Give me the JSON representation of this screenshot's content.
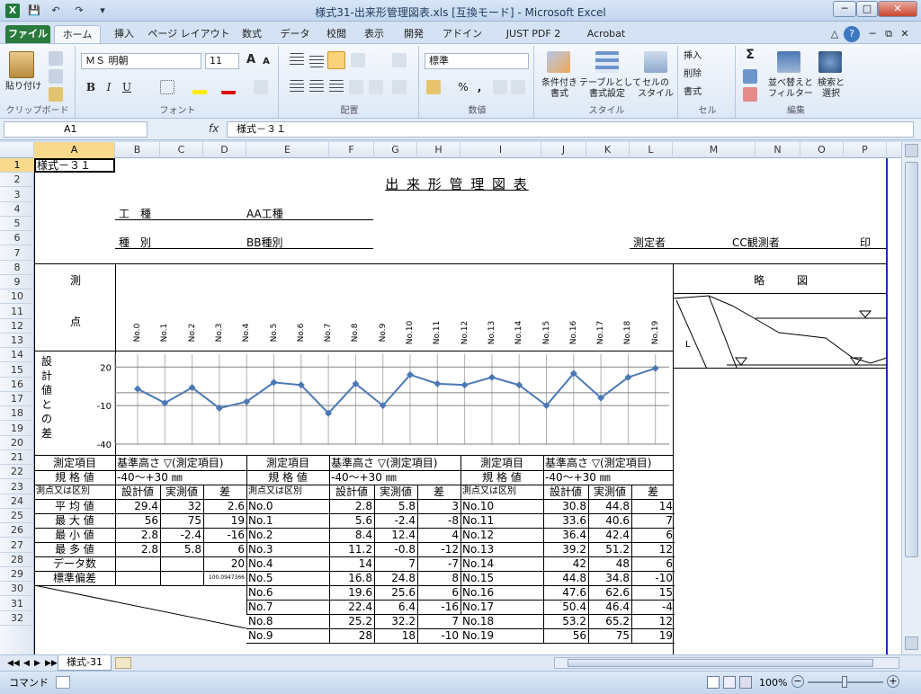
{
  "window": {
    "title": "様式31-出来形管理図表.xls  [互換モード] - Microsoft Excel",
    "app_icon": "X",
    "quick_access": {
      "save": "💾",
      "undo": "↶",
      "redo": "↷",
      "customize": "▾"
    },
    "controls": {
      "minimize": "─",
      "maximize": "□",
      "close": "✕"
    }
  },
  "ribbon_tabs": [
    "ファイル",
    "ホーム",
    "挿入",
    "ページ レイアウト",
    "数式",
    "データ",
    "校閲",
    "表示",
    "開発",
    "アドイン",
    "JUST PDF 2",
    "Acrobat"
  ],
  "ribbon_right": {
    "minimize_ribbon": "△",
    "help": "?",
    "win_min": "─",
    "win_restore": "⧉",
    "win_close": "✕"
  },
  "ribbon": {
    "clipboard": {
      "paste": "貼り付け",
      "label": "クリップボード"
    },
    "font": {
      "name": "ＭＳ 明朝",
      "size": "11",
      "grow": "A",
      "shrink": "A",
      "bold": "B",
      "italic": "I",
      "underline": "U",
      "label": "フォント"
    },
    "alignment": {
      "label": "配置"
    },
    "number": {
      "format": "標準",
      "percent": "%",
      "comma": ",",
      "label": "数値"
    },
    "style": {
      "conditional": "条件付き\n書式",
      "table": "テーブルとして\n書式設定",
      "cell": "セルの\nスタイル",
      "label": "スタイル"
    },
    "cells": {
      "insert": "挿入",
      "delete": "削除",
      "format": "書式",
      "label": "セル"
    },
    "editing": {
      "sum": "Σ",
      "sort": "並べ替えと\nフィルター",
      "find": "検索と\n選択",
      "label": "編集"
    }
  },
  "formula_bar": {
    "name_box": "A1",
    "fx": "fx",
    "content": "様式－３１"
  },
  "columns": [
    "A",
    "B",
    "C",
    "D",
    "E",
    "F",
    "G",
    "H",
    "I",
    "J",
    "K",
    "L",
    "M",
    "N",
    "O",
    "P"
  ],
  "rows": [
    "1",
    "2",
    "3",
    "4",
    "5",
    "6",
    "7",
    "8",
    "9",
    "10",
    "11",
    "12",
    "13",
    "14",
    "15",
    "16",
    "17",
    "18",
    "19",
    "20",
    "21",
    "22",
    "23",
    "24",
    "25",
    "26",
    "27",
    "28",
    "29",
    "30",
    "31",
    "32"
  ],
  "sheet": {
    "form_no": "様式－３１",
    "title": "出 来 形 管 理 図 表",
    "koushu_label": "工　種",
    "koushu_value": "AA工種",
    "shubetsu_label": "種　別",
    "shubetsu_value": "BB種別",
    "sokuteisha_label": "測定者",
    "sokuteisha_value": "CC観測者",
    "seal": "印",
    "sokuten_1": "測",
    "sokuten_2": "点",
    "ryakuzu": "略　　　図",
    "sketch_label": "L",
    "diff_label": [
      "設",
      "計",
      "値",
      "と",
      "の",
      "差"
    ],
    "points": [
      "No.0",
      "No.1",
      "No.2",
      "No.3",
      "No.4",
      "No.5",
      "No.6",
      "No.7",
      "No.8",
      "No.9",
      "No.10",
      "No.11",
      "No.12",
      "No.13",
      "No.14",
      "No.15",
      "No.16",
      "No.17",
      "No.18",
      "No.19"
    ],
    "table_head": {
      "item_label": "測定項目",
      "item_value": "基準高さ ▽(測定項目)",
      "spec_label": "規 格 値",
      "spec_value": "-40～+30 ㎜",
      "point_label": "測点又は区別",
      "design": "設計値",
      "actual": "実測値",
      "diff": "差"
    },
    "stats": [
      {
        "label": "平 均 値",
        "design": "29.4",
        "actual": "32",
        "diff": "2.6"
      },
      {
        "label": "最 大 値",
        "design": "56",
        "actual": "75",
        "diff": "19"
      },
      {
        "label": "最 小 値",
        "design": "2.8",
        "actual": "-2.4",
        "diff": "-16"
      },
      {
        "label": "最 多 値",
        "design": "2.8",
        "actual": "5.8",
        "diff": "6"
      },
      {
        "label": "データ数",
        "design": "",
        "actual": "",
        "diff": "20"
      },
      {
        "label": "標準偏差",
        "design": "",
        "actual": "",
        "diff": "100.0947366"
      }
    ],
    "measurements": [
      {
        "pt": "No.0",
        "design": "2.8",
        "actual": "5.8",
        "diff": "3"
      },
      {
        "pt": "No.1",
        "design": "5.6",
        "actual": "-2.4",
        "diff": "-8"
      },
      {
        "pt": "No.2",
        "design": "8.4",
        "actual": "12.4",
        "diff": "4"
      },
      {
        "pt": "No.3",
        "design": "11.2",
        "actual": "-0.8",
        "diff": "-12"
      },
      {
        "pt": "No.4",
        "design": "14",
        "actual": "7",
        "diff": "-7"
      },
      {
        "pt": "No.5",
        "design": "16.8",
        "actual": "24.8",
        "diff": "8"
      },
      {
        "pt": "No.6",
        "design": "19.6",
        "actual": "25.6",
        "diff": "6"
      },
      {
        "pt": "No.7",
        "design": "22.4",
        "actual": "6.4",
        "diff": "-16"
      },
      {
        "pt": "No.8",
        "design": "25.2",
        "actual": "32.2",
        "diff": "7"
      },
      {
        "pt": "No.9",
        "design": "28",
        "actual": "18",
        "diff": "-10"
      },
      {
        "pt": "No.10",
        "design": "30.8",
        "actual": "44.8",
        "diff": "14"
      },
      {
        "pt": "No.11",
        "design": "33.6",
        "actual": "40.6",
        "diff": "7"
      },
      {
        "pt": "No.12",
        "design": "36.4",
        "actual": "42.4",
        "diff": "6"
      },
      {
        "pt": "No.13",
        "design": "39.2",
        "actual": "51.2",
        "diff": "12"
      },
      {
        "pt": "No.14",
        "design": "42",
        "actual": "48",
        "diff": "6"
      },
      {
        "pt": "No.15",
        "design": "44.8",
        "actual": "34.8",
        "diff": "-10"
      },
      {
        "pt": "No.16",
        "design": "47.6",
        "actual": "62.6",
        "diff": "15"
      },
      {
        "pt": "No.17",
        "design": "50.4",
        "actual": "46.4",
        "diff": "-4"
      },
      {
        "pt": "No.18",
        "design": "53.2",
        "actual": "65.2",
        "diff": "12"
      },
      {
        "pt": "No.19",
        "design": "56",
        "actual": "75",
        "diff": "19"
      }
    ]
  },
  "chart_data": {
    "type": "line",
    "categories": [
      "No.0",
      "No.1",
      "No.2",
      "No.3",
      "No.4",
      "No.5",
      "No.6",
      "No.7",
      "No.8",
      "No.9",
      "No.10",
      "No.11",
      "No.12",
      "No.13",
      "No.14",
      "No.15",
      "No.16",
      "No.17",
      "No.18",
      "No.19"
    ],
    "values": [
      3,
      -8,
      4,
      -12,
      -7,
      8,
      6,
      -16,
      7,
      -10,
      14,
      7,
      6,
      12,
      6,
      -10,
      15,
      -4,
      12,
      19
    ],
    "yticks": [
      "20",
      "-10",
      "-40"
    ],
    "ylim": [
      -40,
      30
    ],
    "reference_lines": [
      20,
      0,
      -10
    ],
    "grid": true,
    "color": "#4a78b5"
  },
  "sheet_tabs": {
    "active": "様式-31",
    "nav": [
      "◀◀",
      "◀",
      "▶",
      "▶▶"
    ]
  },
  "status": {
    "mode": "コマンド",
    "zoom": "100%",
    "zoom_out": "−",
    "zoom_in": "+"
  }
}
